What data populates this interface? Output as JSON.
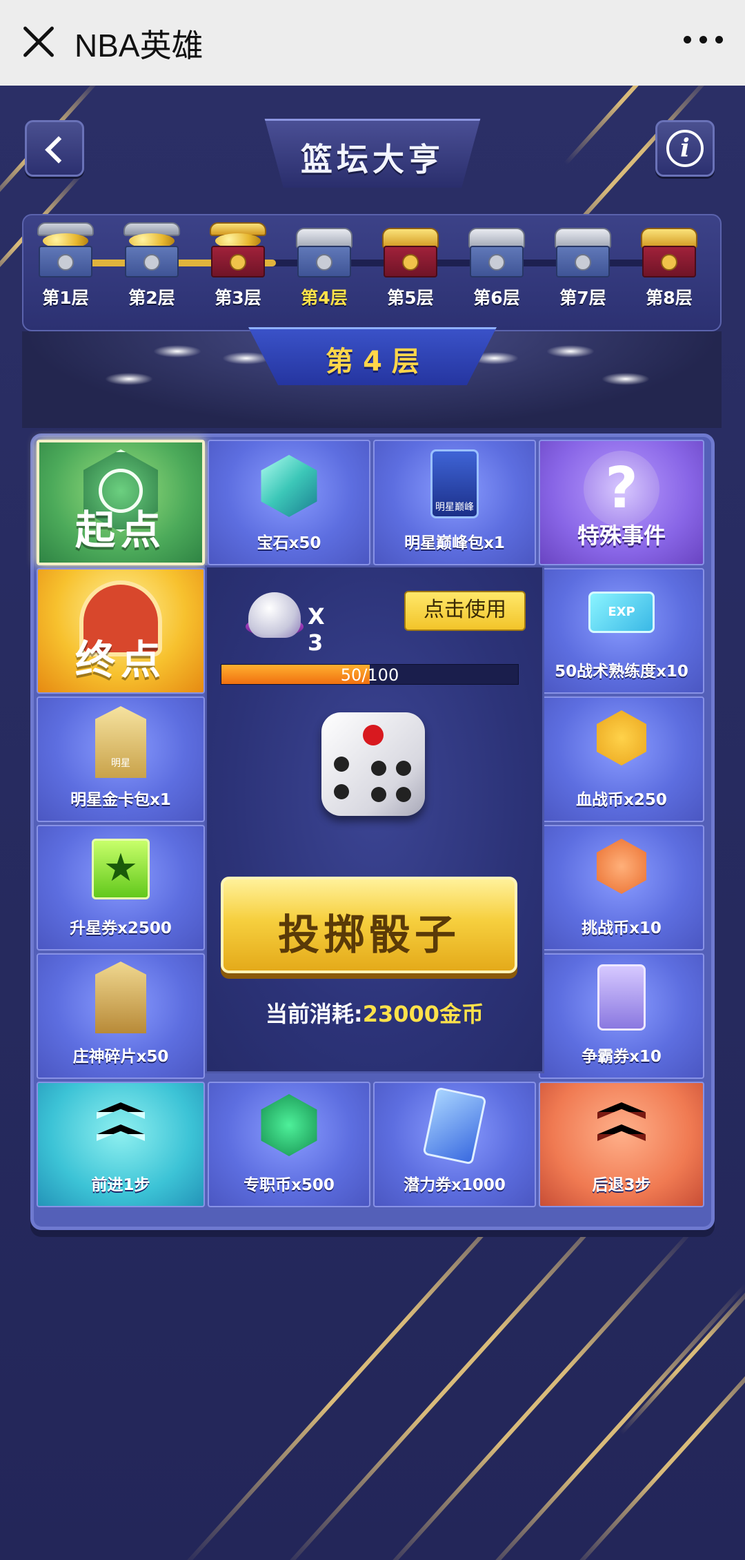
{
  "topbar": {
    "title": "NBA英雄"
  },
  "header": {
    "title": "篮坛大亨"
  },
  "levels": [
    {
      "label": "第1层",
      "state": "open",
      "type": "silver"
    },
    {
      "label": "第2层",
      "state": "open",
      "type": "silver"
    },
    {
      "label": "第3层",
      "state": "open",
      "type": "gold"
    },
    {
      "label": "第4层",
      "state": "current",
      "type": "silver"
    },
    {
      "label": "第5层",
      "state": "locked",
      "type": "gold"
    },
    {
      "label": "第6层",
      "state": "locked",
      "type": "silver"
    },
    {
      "label": "第7层",
      "state": "locked",
      "type": "silver"
    },
    {
      "label": "第8层",
      "state": "locked",
      "type": "gold"
    }
  ],
  "current_floor": "第 4 层",
  "board": {
    "start": "起点",
    "finish": "终点",
    "cells": {
      "gem": "宝石x50",
      "star_pack": "明星巅峰包x1",
      "special": "特殊事件",
      "tactics": "50战术熟练度x10",
      "gold_pack": "明星金卡包x1",
      "blood_coin": "血战币x250",
      "upgrade": "升星券x2500",
      "challenge": "挑战币x10",
      "fragment": "庄神碎片x50",
      "contest": "争霸券x10",
      "forward": "前进1步",
      "pro_coin": "专职币x500",
      "potential": "潜力券x1000",
      "backward": "后退3步"
    },
    "icons": {
      "star_pack": "明星巅峰",
      "tactics": "EXP",
      "gold_pack": "明星"
    }
  },
  "center": {
    "dice_count": "X 3",
    "use_label": "点击使用",
    "progress_text": "50/100",
    "progress_current": 50,
    "progress_max": 100,
    "roll_label": "投掷骰子",
    "cost_label": "当前消耗:",
    "cost_value": "23000金币"
  }
}
